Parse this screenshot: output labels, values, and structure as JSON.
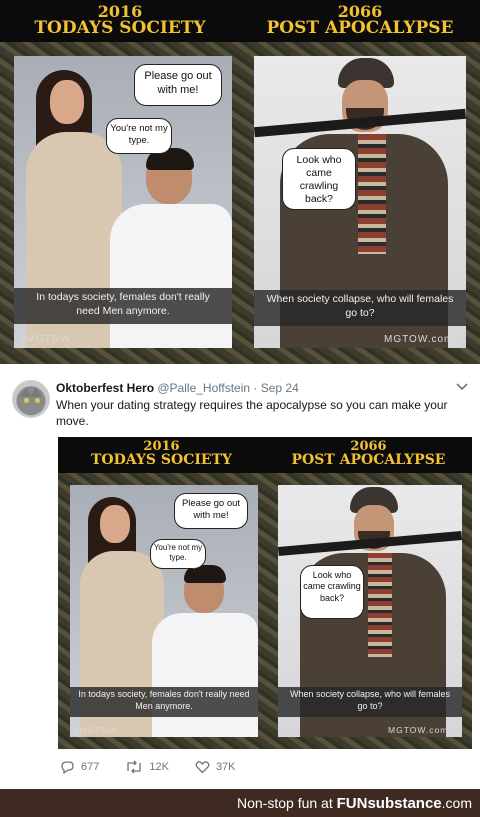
{
  "meme": {
    "left_year": "2016",
    "left_title": "TODAYS SOCIETY",
    "right_year": "2066",
    "right_title": "POST APOCALYPSE",
    "bubble_man": "Please go out with me!",
    "bubble_woman": "You're not my type.",
    "bubble_soldier": "Look who came crawling back?",
    "left_caption": "In todays society, females don't really need Men anymore.",
    "right_caption": "When society collapse, who will females go to?",
    "left_tag": "#MGTOW",
    "right_tag": "MGTOW.com"
  },
  "tweet": {
    "name": "Oktoberfest Hero",
    "handle": "@Palle_Hoffstein",
    "separator": "·",
    "date": "Sep 24",
    "text": "When your dating strategy requires the apocalypse so you can make your move.",
    "replies": "677",
    "retweets": "12K",
    "likes": "37K",
    "caret_icon": "chevron-down-icon"
  },
  "footer": {
    "prefix": "Non-stop fun at ",
    "brand_fun": "FUN",
    "brand_rest": "substance",
    "brand_tld": ".com"
  }
}
